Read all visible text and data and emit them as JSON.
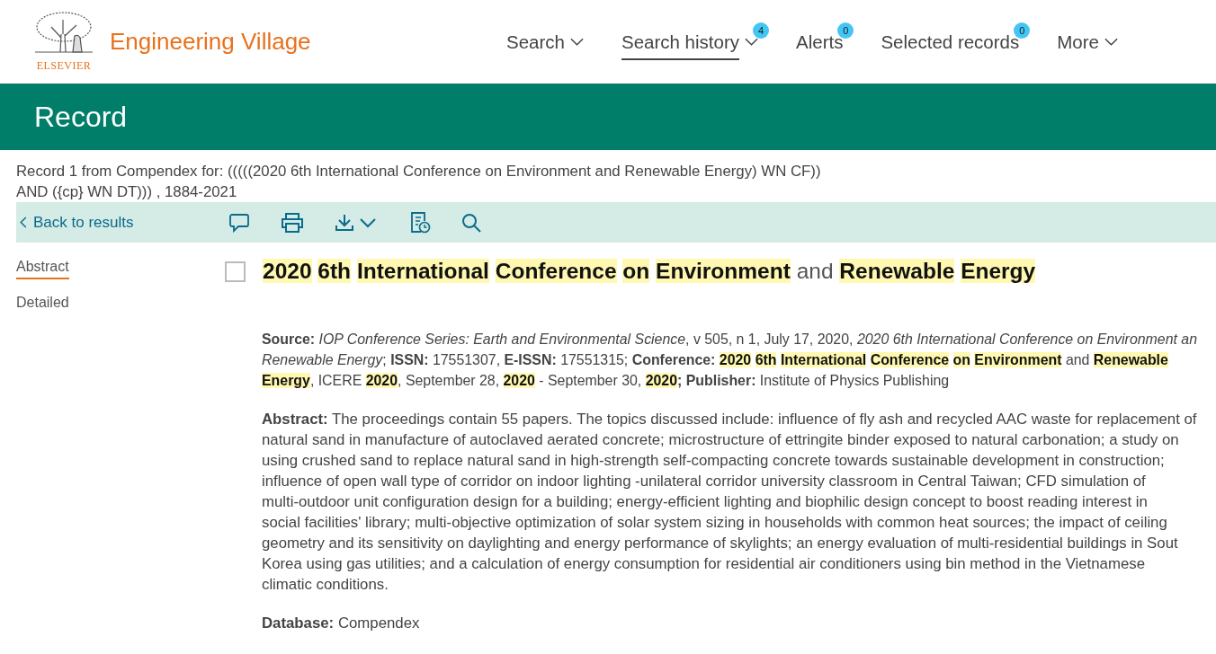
{
  "header": {
    "publisher": "ELSEVIER",
    "brand": "Engineering Village",
    "nav": [
      {
        "label": "Search",
        "has_menu": true,
        "selected": false
      },
      {
        "label": "Search history",
        "has_menu": true,
        "selected": true,
        "badge": "4"
      },
      {
        "label": "Alerts",
        "has_menu": false,
        "selected": false,
        "badge": "0"
      },
      {
        "label": "Selected records",
        "has_menu": false,
        "selected": false,
        "badge": "0"
      },
      {
        "label": "More",
        "has_menu": true,
        "selected": false
      }
    ]
  },
  "banner": {
    "title": "Record"
  },
  "query": {
    "lines": [
      "Record 1 from Compendex for: (((((2020 6th International Conference on Environment and Renewable Energy) WN CF))",
      "AND ({cp} WN DT))) , 1884-2021"
    ]
  },
  "toolbar": {
    "back_link": "Back to results",
    "tools": [
      {
        "kind": "comment"
      },
      {
        "kind": "print"
      },
      {
        "kind": "download"
      },
      {
        "kind": "history"
      },
      {
        "kind": "search"
      }
    ]
  },
  "side_tabs": [
    {
      "label": "Abstract",
      "selected": true
    },
    {
      "label": "Detailed",
      "selected": false
    }
  ],
  "record": {
    "checked": false,
    "title": [
      {
        "text": "2020",
        "highlighted": true
      },
      {
        "text": "6th",
        "highlighted": true
      },
      {
        "text": "International",
        "highlighted": true
      },
      {
        "text": "Conference",
        "highlighted": true
      },
      {
        "text": "on",
        "highlighted": true
      },
      {
        "text": "Environment",
        "highlighted": true
      },
      {
        "text": "and",
        "highlighted": false
      },
      {
        "text": "Renewable",
        "highlighted": true
      },
      {
        "text": "Energy",
        "highlighted": true
      }
    ],
    "source_lines": [
      [
        {
          "kind": "label",
          "text": "Source: "
        },
        {
          "kind": "italic",
          "text": "IOP Conference Series: Earth and Environmental Science"
        },
        {
          "kind": "plain",
          "text": ", v 505, n 1, July 17, 2020, "
        },
        {
          "kind": "italic",
          "text": "2020 6th International Conference on Environment an"
        }
      ],
      [
        {
          "kind": "italic",
          "text": "Renewable Energy"
        },
        {
          "kind": "plain",
          "text": ";  "
        },
        {
          "kind": "label",
          "text": "ISSN:"
        },
        {
          "kind": "plain",
          "text": " 17551307,  "
        },
        {
          "kind": "label",
          "text": "E-ISSN:"
        },
        {
          "kind": "plain",
          "text": " 17551315; "
        },
        {
          "kind": "label",
          "text": "Conference: "
        },
        {
          "kind": "hits",
          "words": [
            "2020",
            "6th",
            "International",
            "Conference",
            "on",
            "Environment"
          ]
        },
        {
          "kind": "plain",
          "text": " and "
        },
        {
          "kind": "hit",
          "text": "Renewable"
        }
      ],
      [
        {
          "kind": "hit",
          "text": "Energy"
        },
        {
          "kind": "plain",
          "text": ", ICERE "
        },
        {
          "kind": "hit",
          "text": "2020"
        },
        {
          "kind": "plain",
          "text": ", September 28, "
        },
        {
          "kind": "hit",
          "text": "2020"
        },
        {
          "kind": "plain",
          "text": " - September 30, "
        },
        {
          "kind": "hit",
          "text": "2020"
        },
        {
          "kind": "label",
          "text": "; Publisher:"
        },
        {
          "kind": "plain",
          "text": " Institute of Physics Publishing"
        }
      ]
    ],
    "abstract": {
      "label": "Abstract:",
      "lines": [
        "The proceedings contain 55 papers. The topics discussed include: influence of fly ash and recycled AAC waste for replacement of",
        "natural sand in manufacture of autoclaved aerated concrete; microstructure of ettringite binder exposed to natural carbonation; a study on",
        "using crushed sand to replace natural sand in high-strength self-compacting concrete towards sustainable development in construction;",
        "influence of open wall type of corridor on indoor lighting -unilateral corridor university classroom in Central Taiwan; CFD simulation of",
        "multi-outdoor unit configuration design for a building; energy-efficient lighting and biophilic design concept to boost reading interest in",
        "social facilities' library; multi-objective optimization of solar system sizing in households with common heat sources; the impact of ceiling",
        "geometry and its sensitivity on daylighting and energy performance of skylights; an energy evaluation of multi-residential buildings in Sout",
        "Korea using gas utilities; and a calculation of energy consumption for residential air conditioners using bin method in the Vietnamese",
        "climatic conditions."
      ]
    },
    "database": {
      "label": "Database:",
      "value": "Compendex"
    }
  }
}
